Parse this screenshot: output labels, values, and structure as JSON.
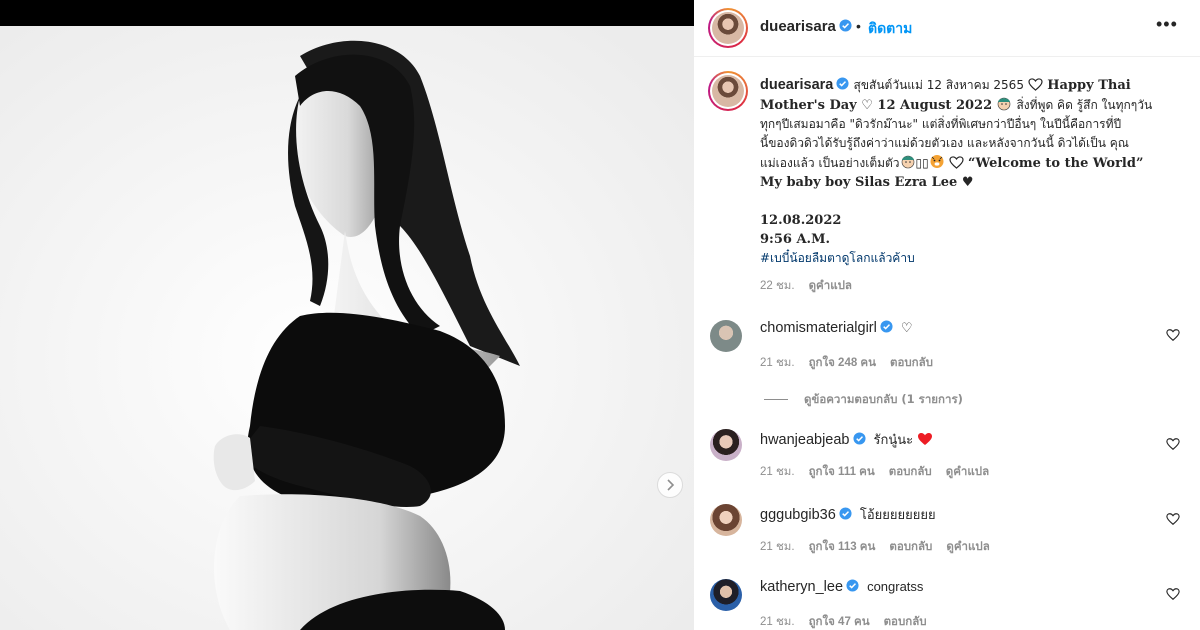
{
  "header": {
    "username": "duearisara",
    "separator": "•",
    "follow_label": "ติดตาม",
    "more_label": "•••"
  },
  "post": {
    "username": "duearisara",
    "caption_line1_thai": "สุขสันต์วันแม่ 12 สิงหาคม 2565",
    "caption_line1_eng": "Happy Thai",
    "caption_line2_eng": "Mother's Day ♡ 12 August 2022",
    "caption_line2_thai": "สิ่งที่พูด คิด รู้สึก ในทุกๆวัน",
    "caption_line3": "ทุกๆปีเสมอมาคือ \"ดิวรักม๊านะ\" แต่สิ่งที่พิเศษกว่าปีอื่นๆ ในปีนี้คือการที่ปี",
    "caption_line4": "นี้ของดิวดิวได้รับรู้ถึงค่าว่าแม่ด้วยตัวเอง และหลังจากวันนี้ ดิวได้เป็น คุณ",
    "caption_line5_thai": "แม่เองแล้ว เป็นอย่างเต็มตัว",
    "caption_line5_glyphs": "▯▯",
    "caption_line5_eng": "“Welcome to the World”",
    "caption_line6": "My baby boy Silas Ezra Lee ♥",
    "date": "12.08.2022",
    "time": "9:56 A.M.",
    "hashtag": "#เบบี๋น้อยลืมตาดูโลกแล้วค้าบ",
    "age": "22 ชม.",
    "translate": "ดูคำแปล"
  },
  "comments": [
    {
      "username": "chomismaterialgirl",
      "text": "♡",
      "age": "21 ชม.",
      "likes": "ถูกใจ 248 คน",
      "reply": "ตอบกลับ",
      "translate": ""
    },
    {
      "username": "hwanjeabjeab",
      "text": "รักนู๋นะ",
      "age": "21 ชม.",
      "likes": "ถูกใจ 111 คน",
      "reply": "ตอบกลับ",
      "translate": "ดูคำแปล"
    },
    {
      "username": "gggubgib36",
      "text": "โอ้ยยยยยยยย",
      "age": "21 ชม.",
      "likes": "ถูกใจ 113 คน",
      "reply": "ตอบกลับ",
      "translate": "ดูคำแปล"
    },
    {
      "username": "katheryn_lee",
      "text": "congratss",
      "age": "21 ชม.",
      "likes": "ถูกใจ 47 คน",
      "reply": "ตอบกลับ",
      "translate": ""
    }
  ],
  "view_replies": "ดูข้อความตอบกลับ (1 รายการ)",
  "colors": {
    "accent": "#0095f6",
    "verified": "#3897f0",
    "text": "#262626",
    "muted": "#8e8e8e",
    "heart_red": "#ed1c24"
  },
  "icons": {
    "verified": "verified-badge-icon",
    "heart": "heart-outline-icon",
    "next": "chevron-right-icon"
  }
}
